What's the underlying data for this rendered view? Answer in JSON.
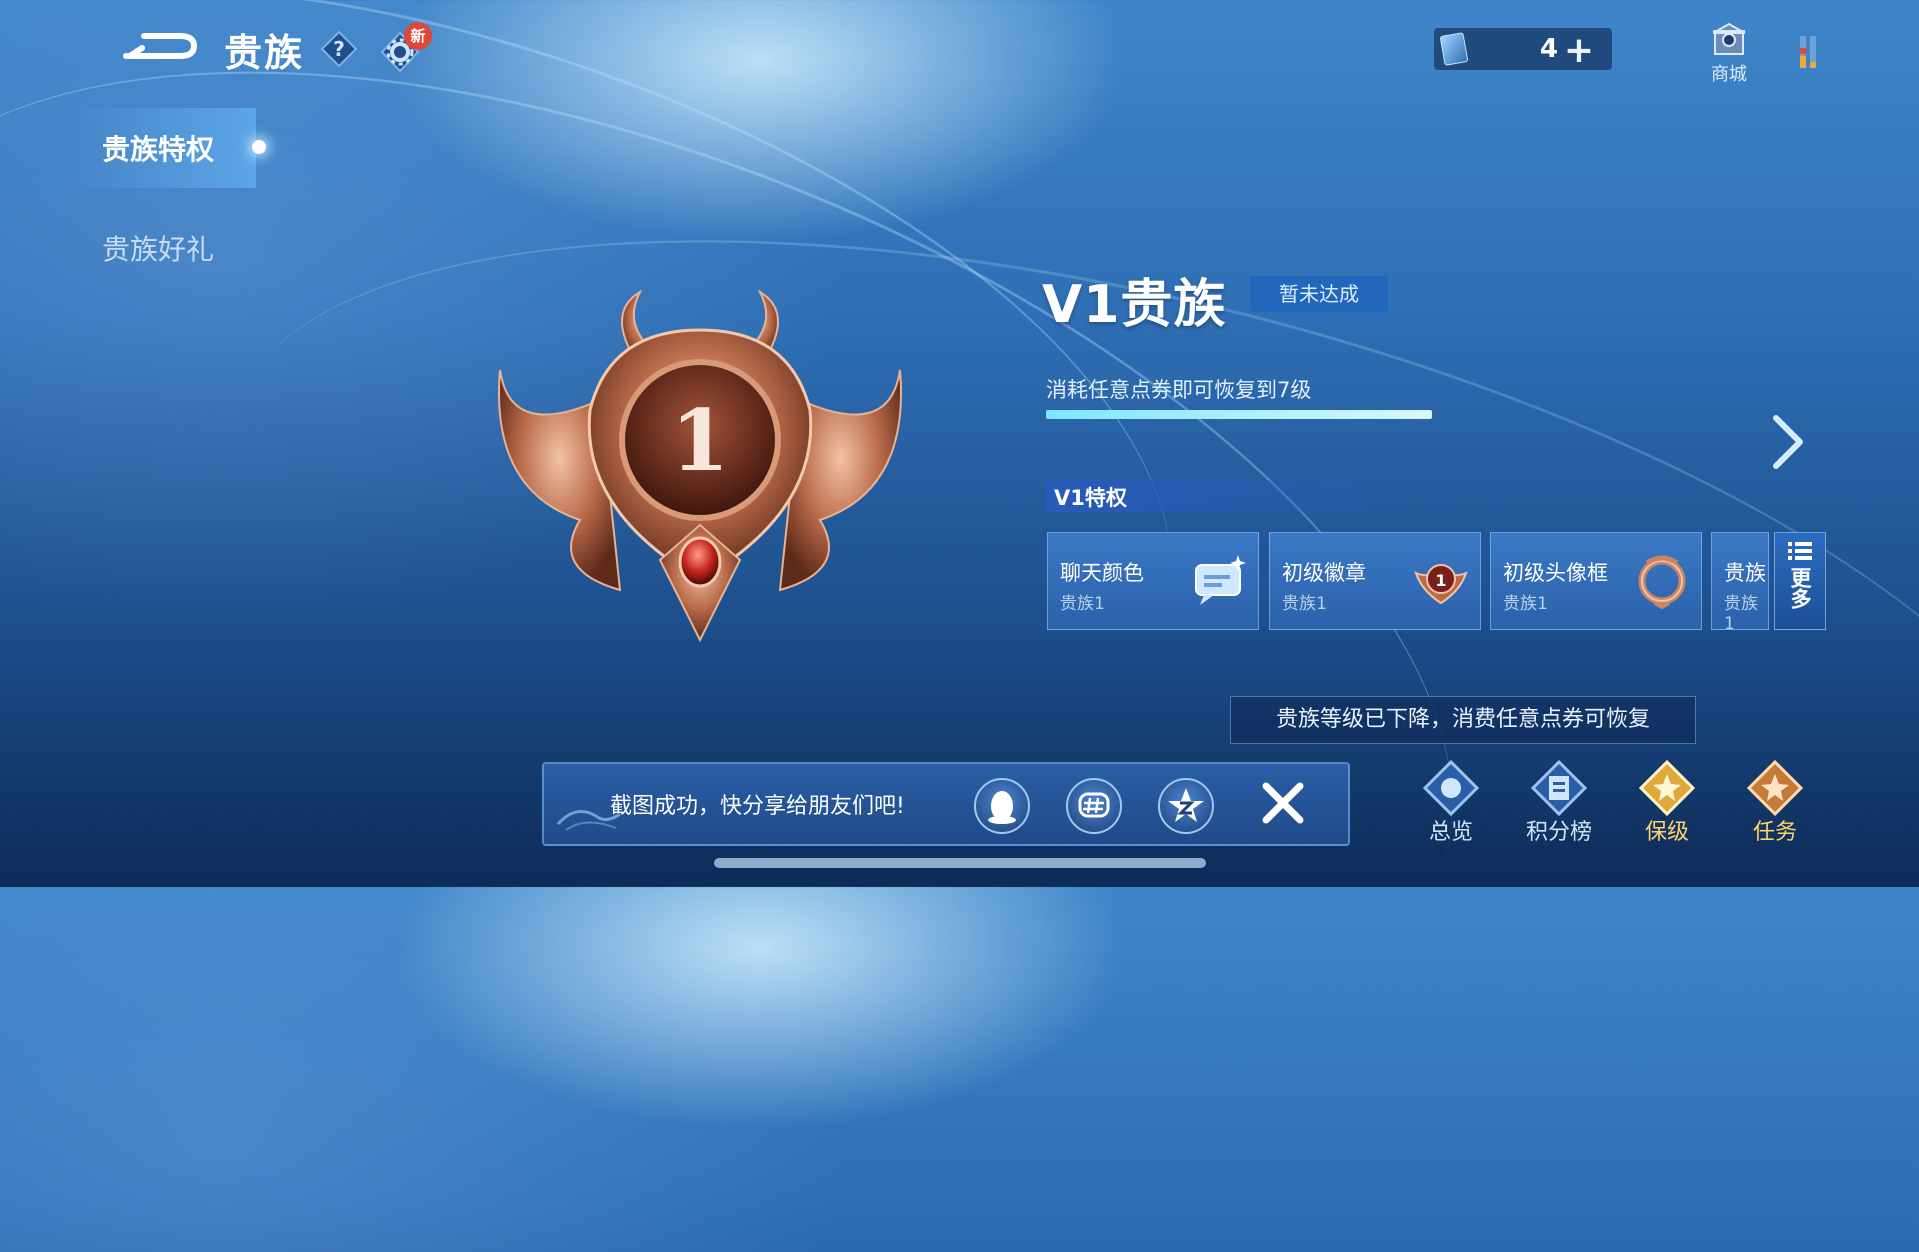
{
  "header": {
    "title": "贵族",
    "settings_badge": "新"
  },
  "currency": {
    "count": "4",
    "plus": "+"
  },
  "shop": {
    "label": "商城"
  },
  "sidebar": {
    "items": [
      {
        "label": "贵族特权",
        "active": true
      },
      {
        "label": "贵族好礼",
        "active": false
      }
    ]
  },
  "emblem": {
    "level": "1"
  },
  "vip": {
    "title": "V1贵族",
    "status": "暂未达成",
    "progress_text": "消耗任意点券即可恢复到7级",
    "progress": 1.0
  },
  "privileges": {
    "header": "V1特权",
    "items": [
      {
        "name": "聊天颜色",
        "sub": "贵族1"
      },
      {
        "name": "初级徽章",
        "sub": "贵族1"
      },
      {
        "name": "初级头像框",
        "sub": "贵族1"
      },
      {
        "name": "贵族",
        "sub": "贵族1"
      }
    ],
    "more_label": "更多"
  },
  "tooltip": "贵族等级已下降，消费任意点券可恢复",
  "share": {
    "text": "截图成功，快分享给朋友们吧!"
  },
  "bottom_nav": [
    {
      "label": "总览"
    },
    {
      "label": "积分榜"
    },
    {
      "label": "保级"
    },
    {
      "label": "任务"
    }
  ],
  "colors": {
    "accent_gold": "#ffd36b",
    "bronze": "#b86a4a",
    "background": "#2f6fb5"
  }
}
